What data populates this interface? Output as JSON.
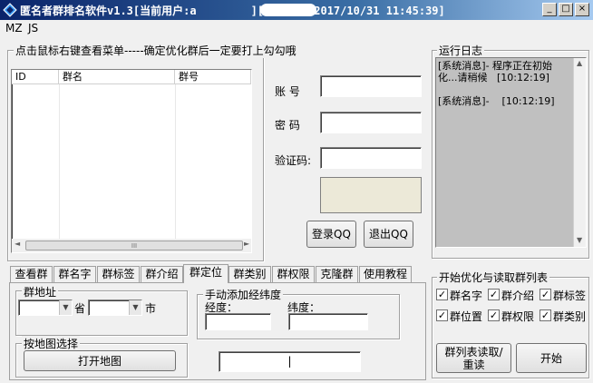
{
  "window": {
    "title_left": "匿名者群排名软件v1.3[当前用户:a",
    "title_right": "][到期时间:2017/10/31 11:45:39]",
    "min": "_",
    "max": "□",
    "close": "×"
  },
  "menu": [
    "MZ",
    "JS"
  ],
  "group_list": {
    "label": "点击鼠标右键查看菜单-----确定优化群后一定要打上勾勾哦",
    "columns": [
      "ID",
      "群名",
      "群号"
    ],
    "scroll_left": "◄",
    "scroll_right": "►",
    "scroll_grip": "III"
  },
  "login": {
    "account_label": "账 号",
    "password_label": "密 码",
    "captcha_label": "验证码:",
    "login_button": "登录QQ",
    "logout_button": "退出QQ"
  },
  "log": {
    "label": "运行日志",
    "lines": [
      "[系统消息]- 程序正在初始",
      "化...请稍候   [10:12:19]",
      "",
      "[系统消息]-    [10:12:19]"
    ],
    "up": "▲",
    "down": "▼"
  },
  "tabs": [
    "查看群",
    "群名字",
    "群标签",
    "群介绍",
    "群定位",
    "群类别",
    "群权限",
    "克隆群",
    "使用教程"
  ],
  "active_tab": 4,
  "location": {
    "address_label": "群地址",
    "province_label": "省",
    "city_label": "市",
    "manual_label": "手动添加经纬度",
    "longitude_label": "经度：",
    "latitude_label": "纬度：",
    "map_label": "按地图选择",
    "open_map_button": "打开地图",
    "bottom_input_value": "|"
  },
  "optimize": {
    "label": "开始优化与读取群列表",
    "checks": [
      "群名字",
      "群介绍",
      "群标签",
      "群位置",
      "群权限",
      "群类别"
    ],
    "read_button_line1": "群列表读取/",
    "read_button_line2": "重读",
    "start_button": "开始"
  }
}
